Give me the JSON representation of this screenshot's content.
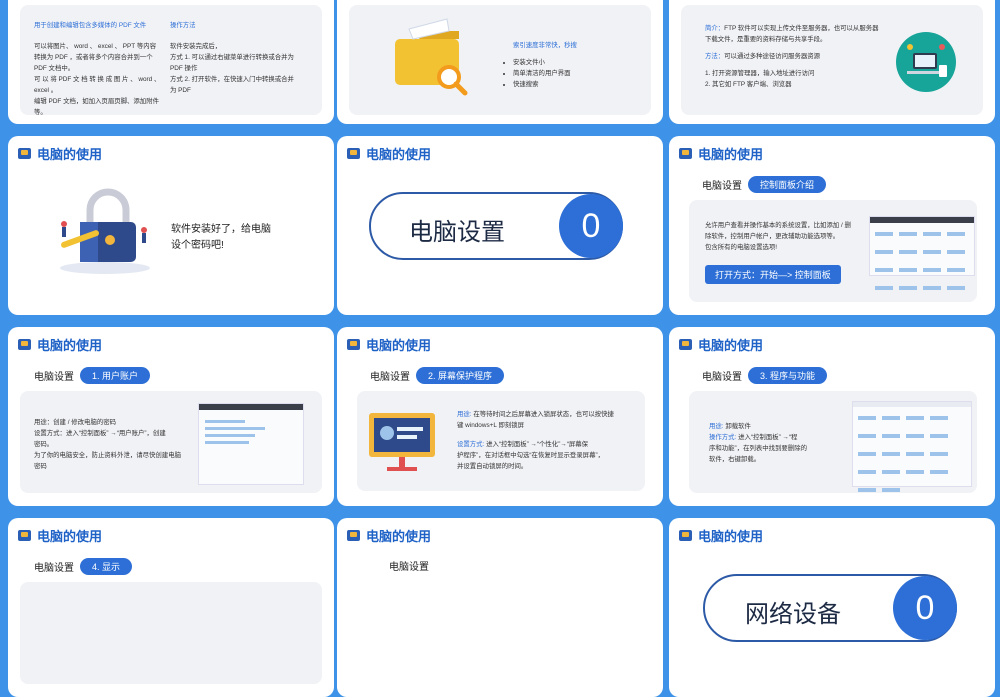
{
  "header_title": "电脑的使用",
  "slide1": {
    "col1_heading": "用于创建和编辑包含多媒体的 PDF 文件",
    "col1_lines": [
      "可以将图片、 word 、 excel 、 PPT 等内容",
      "转换为 PDF ，或者将多个内容合并到一个",
      "PDF 文档中。",
      "可 以 将 PDF 文 档 转 换 成 图 片 、 word 、",
      "excel 。",
      "编辑 PDF 文档，如加入页眉页脚、添加附件",
      "等。"
    ],
    "col2_heading": "操作方法",
    "col2_lines": [
      "软件安装完成后，",
      "方式 1. 可以通过右键菜单进行转换或合并为",
      "PDF 操作",
      "方式 2. 打开软件，在快速入门中转换或合并",
      "为 PDF"
    ]
  },
  "slide2": {
    "heading": "索引速度非常快，秒搜",
    "bullets": [
      "安装文件小",
      "简单清洁的用户界面",
      "快速搜索"
    ]
  },
  "slide3": {
    "line1_label": "简介：",
    "line1": "FTP 软件可以实现上传文件至服务器，也可以从服务器",
    "line2": "下载文件，是重要的资料存储与共享手段。",
    "line3_label": "方法：",
    "line3": "可以通过多种途径访问服务器资源",
    "step1": "1. 打开资源管理器，输入地址进行访问",
    "step2": "2. 其它如 FTP 客户端、浏览器"
  },
  "slide4": {
    "text1": "软件安装好了，给电脑",
    "text2": "设个密码吧!"
  },
  "slide5": {
    "title": "电脑设置",
    "number": "0"
  },
  "slide6": {
    "sub_label": "电脑设置",
    "pill": "控制面板介绍",
    "lines": [
      "允许用户查看并操作基本的系统设置，比如添加 / 删",
      "除软件，控制用户帐户，更改辅助功能选项等。",
      "包含所有的电脑设置选项!"
    ],
    "button": "打开方式：开始—> 控制面板"
  },
  "slide7": {
    "sub_label": "电脑设置",
    "pill": "1. 用户账户",
    "lines": [
      "用途：创建 / 修改电脑的密码",
      "设置方式：进入“控制面板” →“用户账户”，创建",
      "密码。",
      "为了你的电脑安全，防止资料外泄，请尽快创建电脑",
      "密码"
    ]
  },
  "slide8": {
    "sub_label": "电脑设置",
    "pill": "2. 屏幕保护程序",
    "use_label": "用途:",
    "use_lines": [
      "在等待时间之后屏幕进入锁屏状态，也可以按快捷",
      "键 windows+L 即刻锁屏"
    ],
    "set_label": "设置方式:",
    "set_lines": [
      "进入“控制面板” →“个性化”→“屏幕保",
      "护程序”，在对话框中勾选“在恢复时显示登录屏幕”，",
      "并设置自动锁屏的时间。"
    ]
  },
  "slide9": {
    "sub_label": "电脑设置",
    "pill": "3. 程序与功能",
    "use_label": "用途:",
    "use": "卸载软件",
    "set_label": "操作方式:",
    "set_lines": [
      "进入“控制面板” →“程",
      "序和功能”，在列表中找到要删除的",
      "软件，右键卸载。"
    ]
  },
  "slide10": {
    "sub_label": "电脑设置",
    "pill": "4. 显示"
  },
  "slide11": {
    "sub_label": "电脑设置"
  },
  "slide12": {
    "title": "网络设备",
    "number": "0"
  },
  "colors": {
    "accent": "#2d6fd6",
    "background": "#3e92e8",
    "title": "#1f62c7"
  }
}
